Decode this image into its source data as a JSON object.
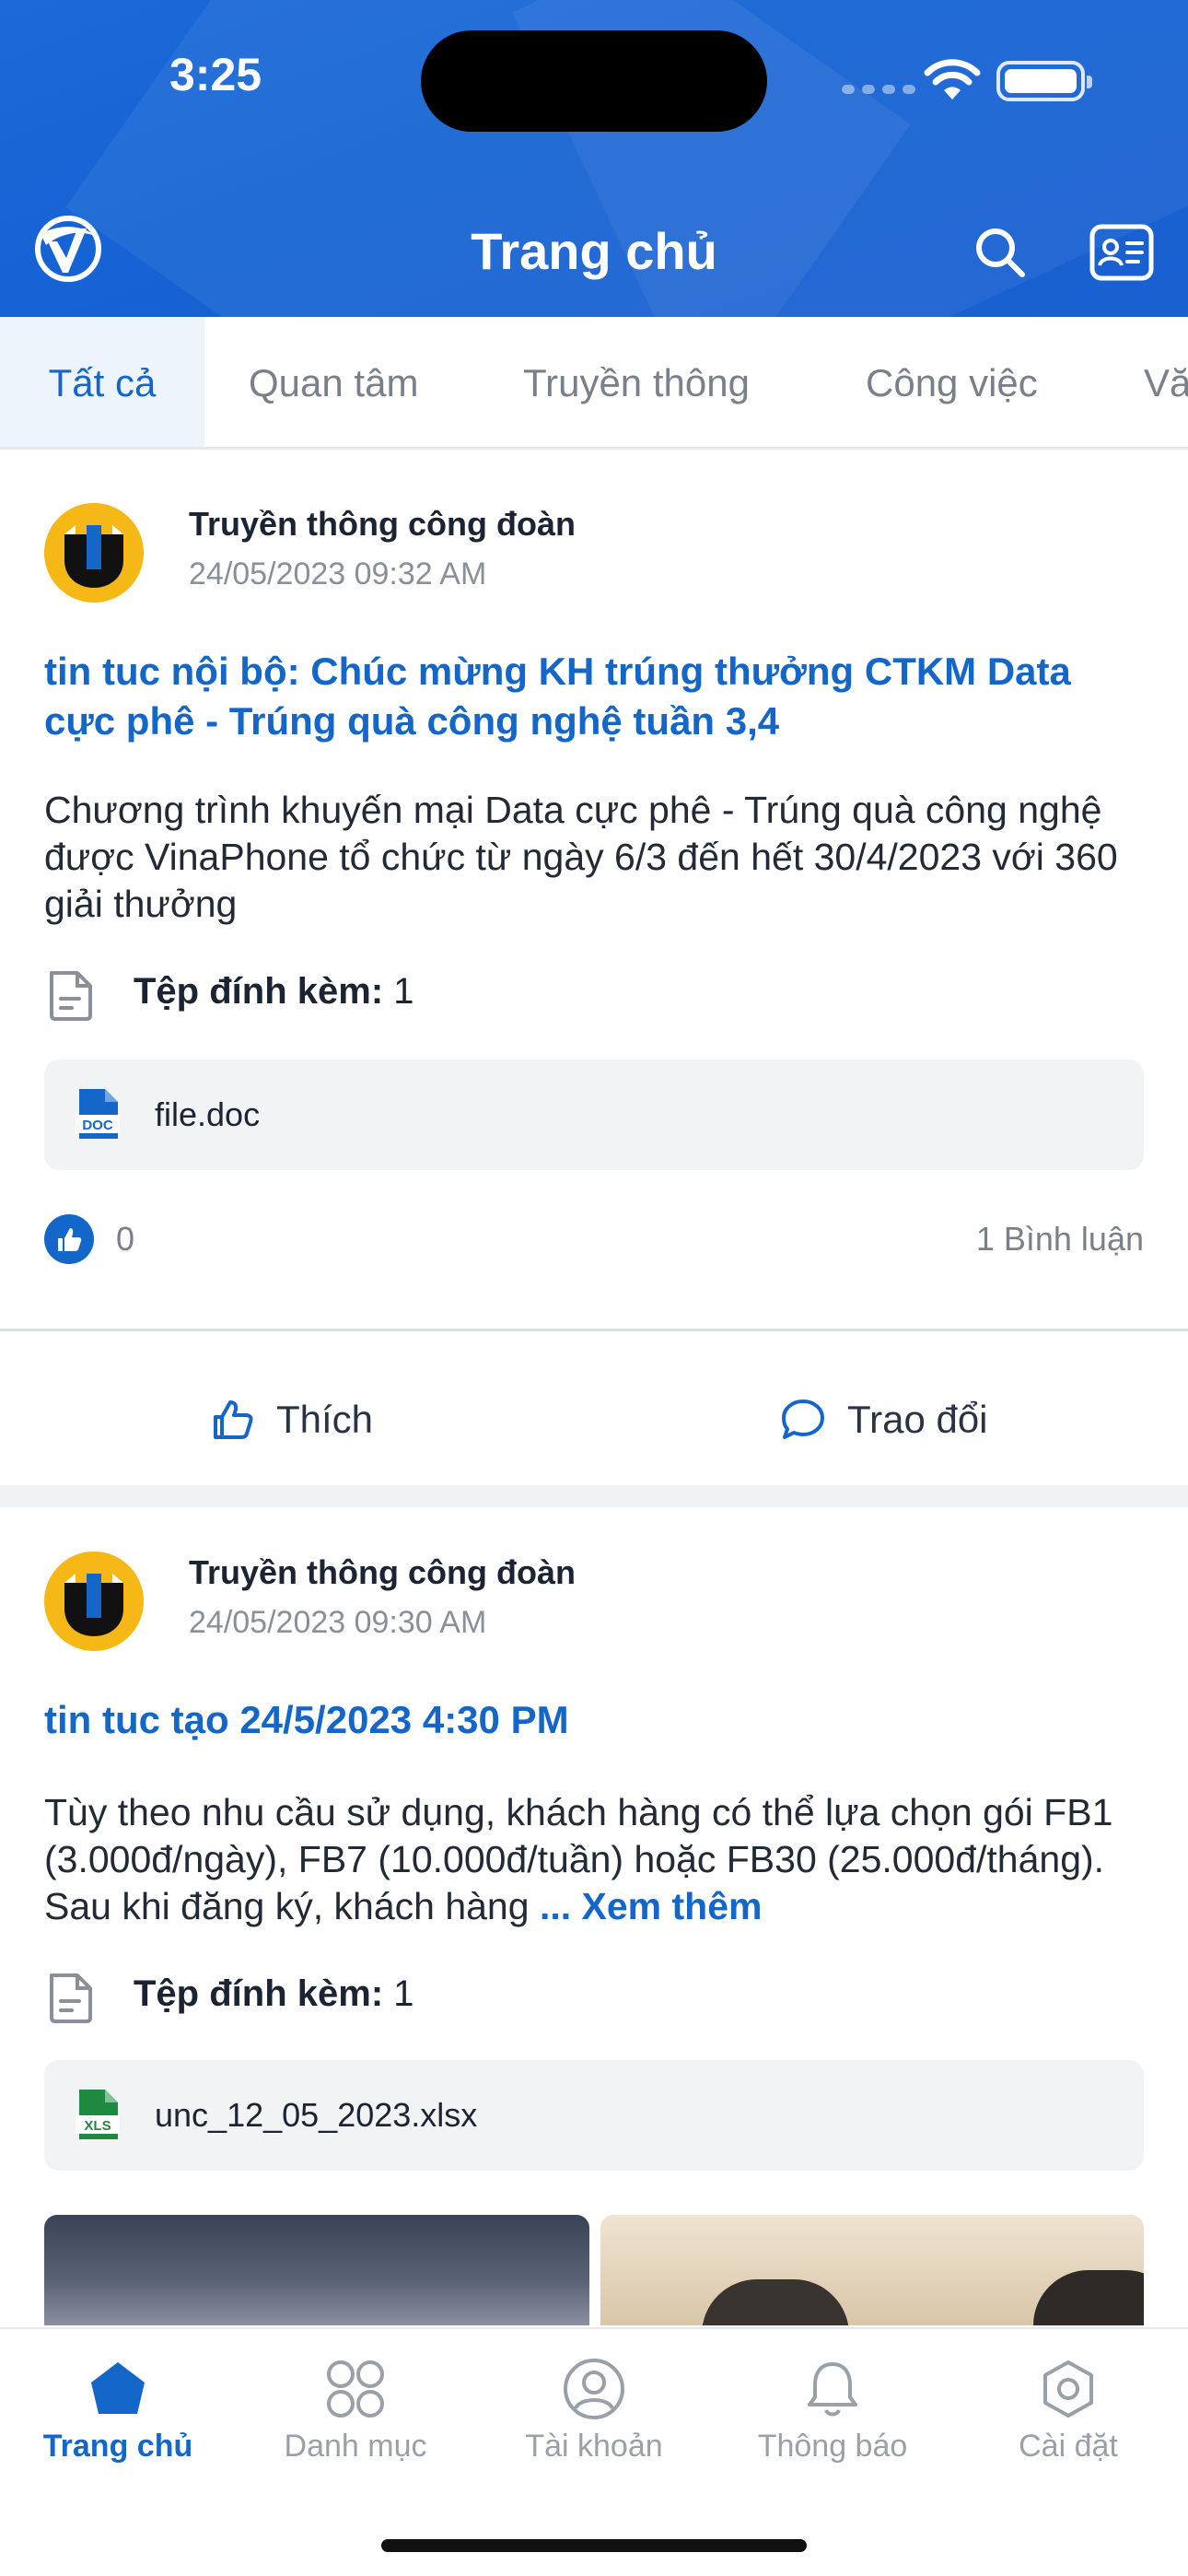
{
  "status_bar": {
    "time": "3:25"
  },
  "header": {
    "title": "Trang chủ"
  },
  "tabs": [
    {
      "label": "Tất cả"
    },
    {
      "label": "Quan tâm"
    },
    {
      "label": "Truyền thông"
    },
    {
      "label": "Công việc"
    },
    {
      "label": "Vă"
    }
  ],
  "posts": [
    {
      "author": "Truyền thông công đoàn",
      "time": "24/05/2023 09:32 AM",
      "title": "tin tuc nội bộ: Chúc mừng KH trúng thưởng CTKM Data cực phê - Trúng quà công nghệ tuần 3,4",
      "body": "Chương trình khuyến mại Data cực phê - Trúng quà công nghệ được VinaPhone tổ chức từ ngày 6/3 đến hết 30/4/2023 với 360 giải thưởng",
      "attachment_label": "Tệp đính kèm:",
      "attachment_count": "1",
      "file_name": "file.doc",
      "file_icon_text": "DOC",
      "likes": "0",
      "comments": "1 Bình luận",
      "like_action": "Thích",
      "comment_action": "Trao đổi"
    },
    {
      "author": "Truyền thông công đoàn",
      "time": "24/05/2023 09:30 AM",
      "title": "tin tuc tạo 24/5/2023 4:30 PM",
      "body": "Tùy theo nhu cầu sử dụng, khách hàng có thể lựa chọn gói FB1 (3.000đ/ngày), FB7 (10.000đ/tuần) hoặc FB30 (25.000đ/tháng). Sau khi đăng ký, khách hàng",
      "more": "... Xem thêm",
      "attachment_label": "Tệp đính kèm:",
      "attachment_count": "1",
      "file_name": "unc_12_05_2023.xlsx",
      "file_icon_text": "XLS"
    }
  ],
  "bottom_nav": [
    {
      "label": "Trang chủ",
      "icon": "home-icon"
    },
    {
      "label": "Danh mục",
      "icon": "grid-icon"
    },
    {
      "label": "Tài khoản",
      "icon": "user-icon"
    },
    {
      "label": "Thông báo",
      "icon": "bell-icon"
    },
    {
      "label": "Cài đặt",
      "icon": "gear-icon"
    }
  ],
  "colors": {
    "primary": "#1466c8",
    "header": "#1c6ad9",
    "avatar_bg": "#f6b817"
  }
}
